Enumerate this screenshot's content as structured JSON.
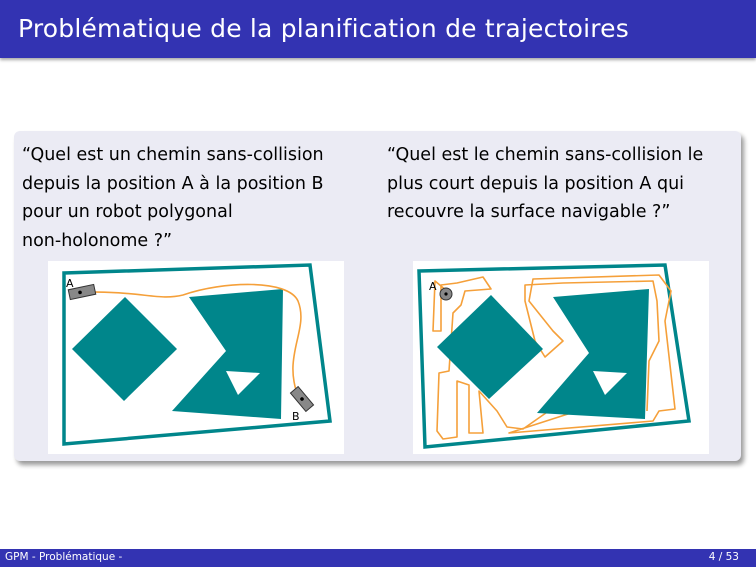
{
  "slide": {
    "title": "Problématique de la planification de trajectoires"
  },
  "questions": {
    "left": {
      "line1": "“Quel est un chemin sans-collision",
      "line2": "depuis la position A à la position B",
      "line3": "pour un robot polygonal",
      "line4": "non-holonome ?”"
    },
    "right": {
      "line1": "“Quel est le chemin sans-collision le",
      "line2": "plus court depuis la position A qui",
      "line3": "recouvre la surface navigable ?”"
    }
  },
  "figures": {
    "left": {
      "label_a": "A",
      "label_b": "B"
    },
    "right": {
      "label_a": "A"
    }
  },
  "colors": {
    "obstacle": "#00868b",
    "path": "#f5a03a",
    "title_bar": "#3333b2",
    "block_background": "#ebebf4"
  },
  "footer": {
    "section": "GPM - Problématique -",
    "page": "4",
    "total": "53"
  }
}
